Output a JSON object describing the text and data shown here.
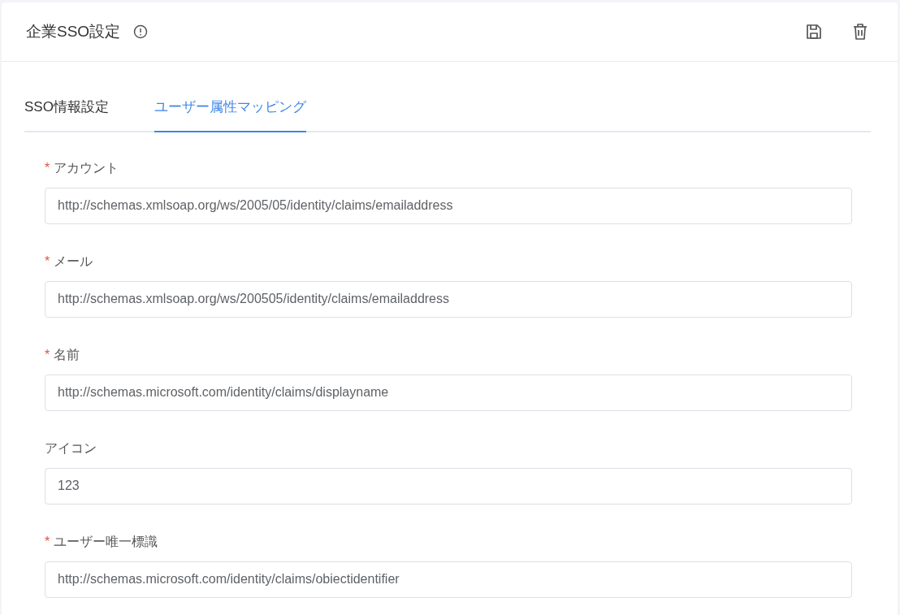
{
  "header": {
    "title": "企業SSO設定"
  },
  "tabs": [
    {
      "label": "SSO情報設定",
      "selected": false
    },
    {
      "label": "ユーザー属性マッピング",
      "selected": true
    }
  ],
  "fields": [
    {
      "mark": "*",
      "label": "アカウント",
      "value": "http://schemas.xmlsoap.org/ws/2005/05/identity/claims/emailaddress"
    },
    {
      "mark": "*",
      "label": "メール",
      "value": "http://schemas.xmlsoap.org/ws/200505/identity/claims/emailaddress"
    },
    {
      "mark": "*",
      "label": "名前",
      "value": "http://schemas.microsoft.com/identity/claims/displayname"
    },
    {
      "label": "アイコン",
      "value": "123"
    },
    {
      "mark": "*",
      "label": "ユーザー唯一標識",
      "value": "http://schemas.microsoft.com/identity/claims/obiectidentifier"
    }
  ]
}
